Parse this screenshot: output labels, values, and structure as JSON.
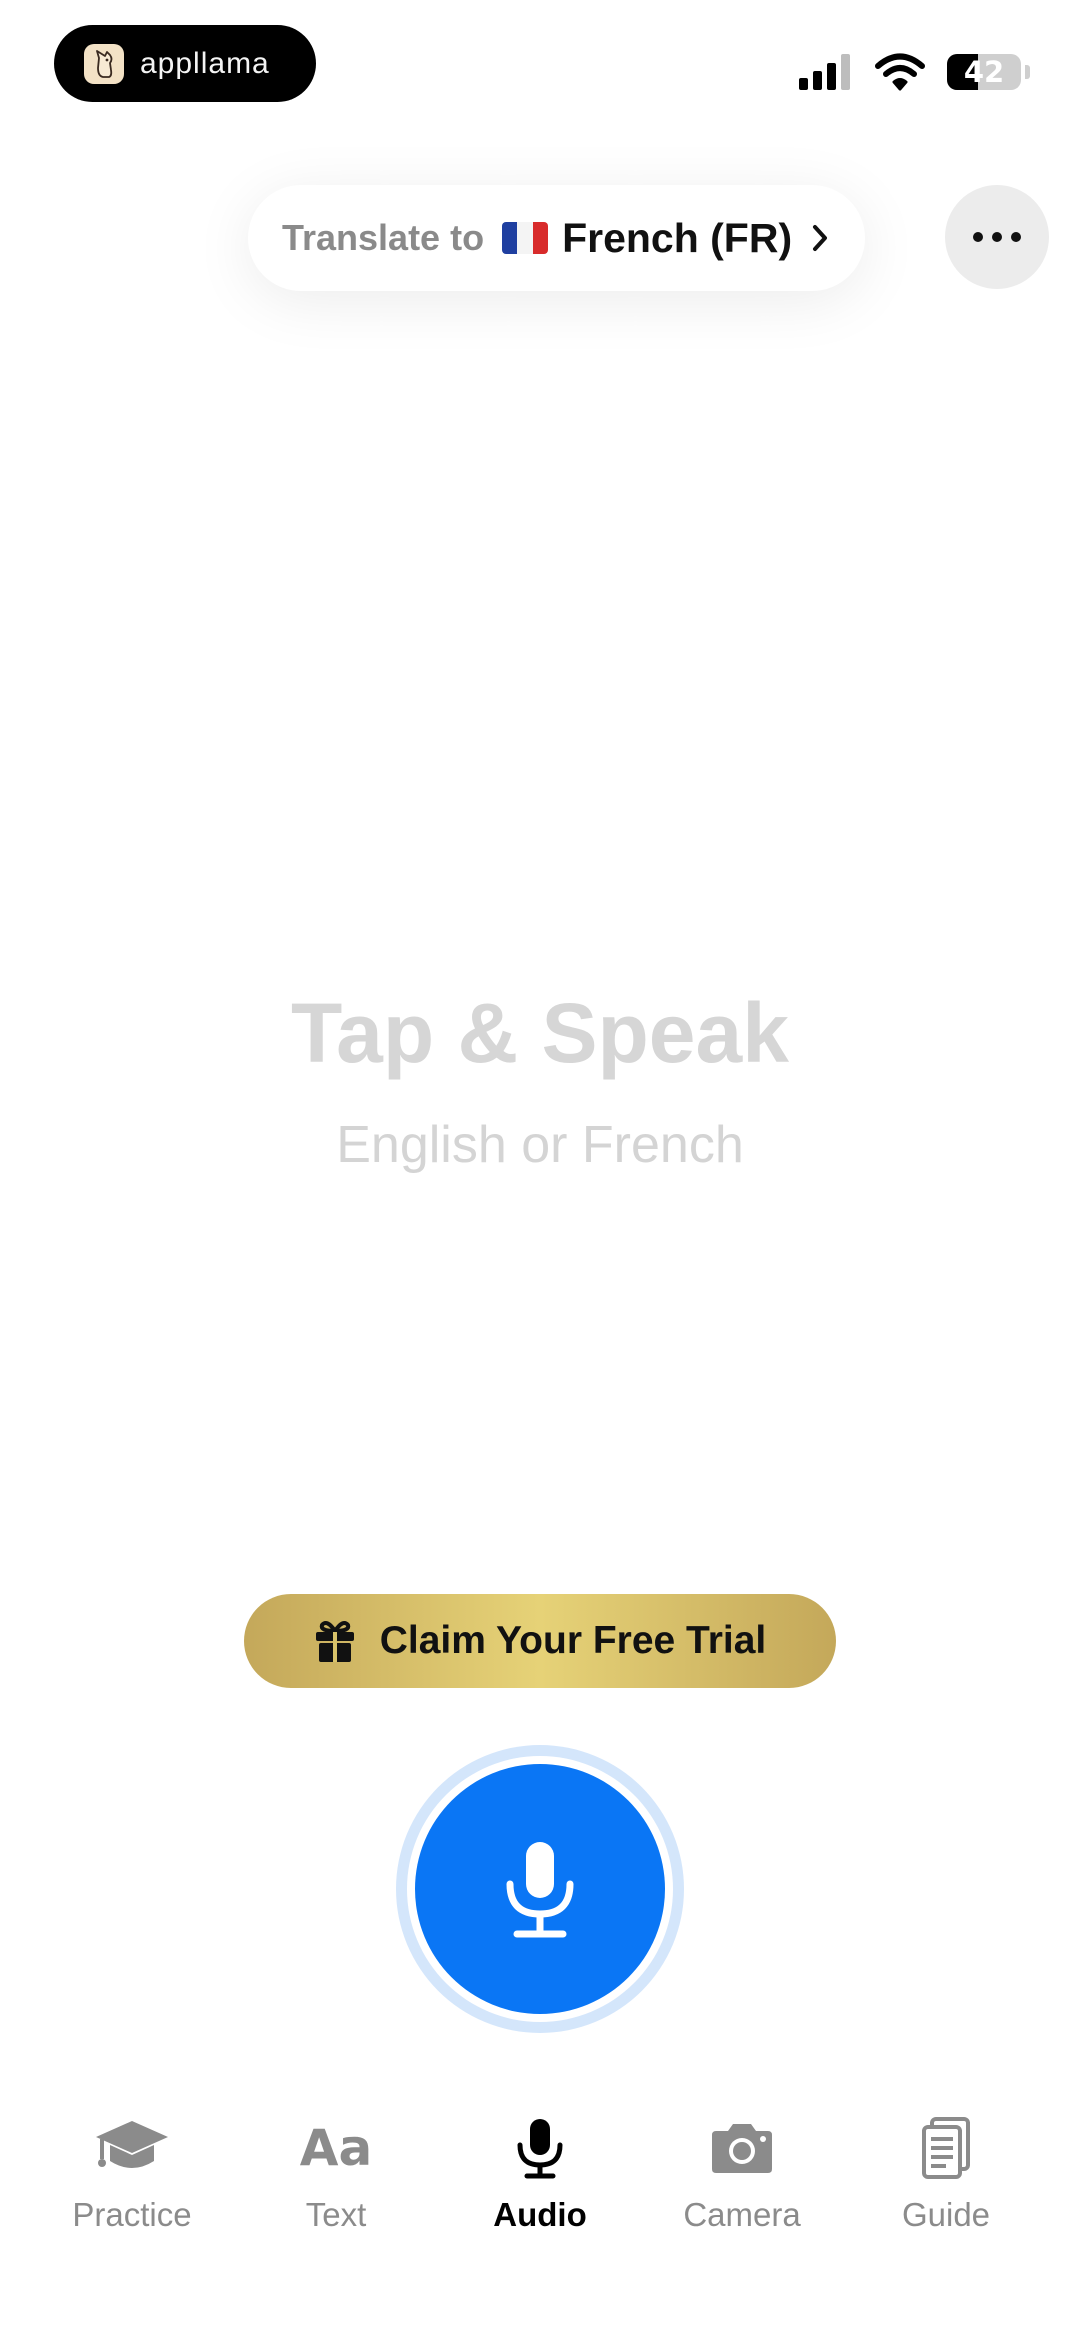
{
  "status_bar": {
    "app_pill": {
      "name": "appllama",
      "icon": "llama-logo-icon"
    },
    "signal_icon": "cellular-signal-icon",
    "wifi_icon": "wifi-icon",
    "battery": {
      "level": 42,
      "label": "42"
    }
  },
  "header": {
    "translate_label": "Translate to",
    "flag_icon": "france-flag-icon",
    "language": "French (FR)",
    "chevron_icon": "chevron-right-icon",
    "more_icon": "more-dots-icon"
  },
  "main": {
    "hint_title": "Tap & Speak",
    "hint_subtitle": "English or French"
  },
  "trial": {
    "icon": "gift-icon",
    "label": "Claim Your Free Trial"
  },
  "mic_button": {
    "icon": "microphone-icon"
  },
  "tabs": [
    {
      "label": "Practice",
      "icon": "graduation-cap-icon",
      "active": false
    },
    {
      "label": "Text",
      "icon": "text-aa-icon",
      "icon_text": "Aa",
      "active": false
    },
    {
      "label": "Audio",
      "icon": "microphone-icon",
      "active": true
    },
    {
      "label": "Camera",
      "icon": "camera-icon",
      "active": false
    },
    {
      "label": "Guide",
      "icon": "document-icon",
      "active": false
    }
  ],
  "colors": {
    "accent_blue": "#0a76f5",
    "mic_ring": "#d4e6fb",
    "trial_gold": "#e6d277",
    "hint_gray": "#d6d6d6",
    "tab_inactive": "#8b8b8b"
  }
}
